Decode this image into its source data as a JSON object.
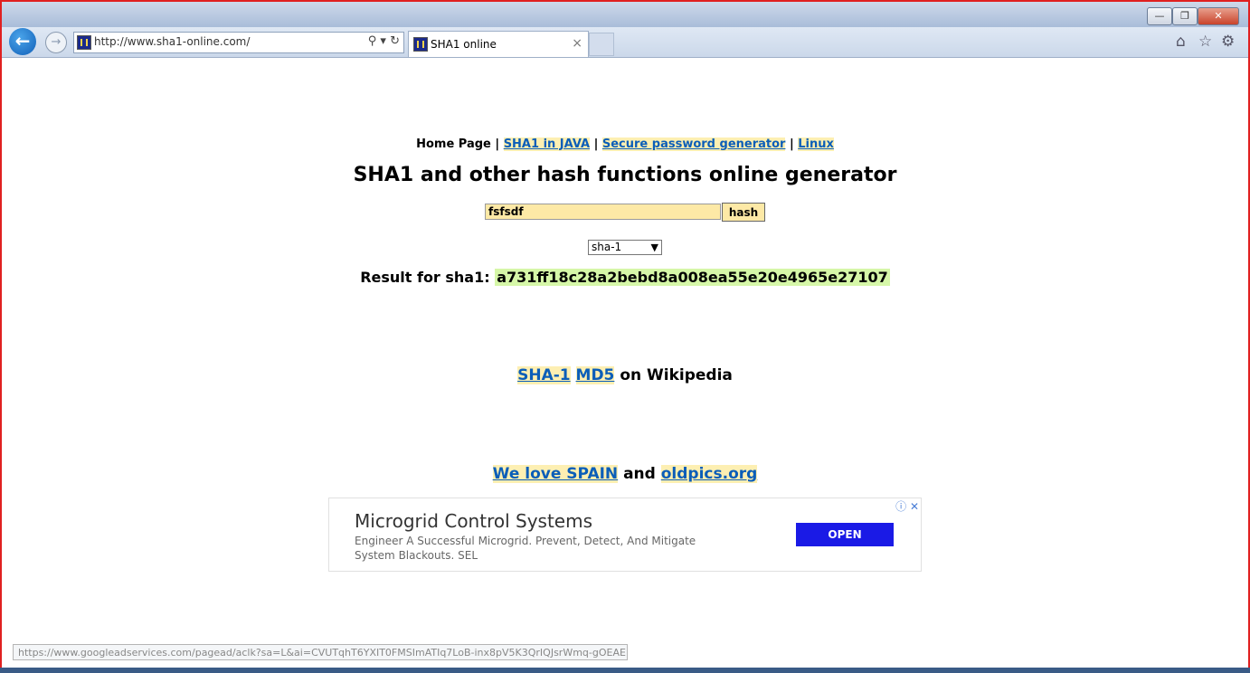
{
  "browser": {
    "address_url": "http://www.sha1-online.com/",
    "tab_title": "SHA1 online",
    "tab_close": "×",
    "back_glyph": "←",
    "forward_glyph": "→",
    "addr_icons": "⚲ ▾ ↻",
    "min_glyph": "—",
    "max_glyph": "❐",
    "close_glyph": "✕",
    "home_glyph": "⌂",
    "fav_glyph": "☆",
    "settings_glyph": "⚙"
  },
  "nav": {
    "home": "Home Page",
    "sep": "|",
    "sha1_java": "SHA1 in JAVA",
    "password_gen": "Secure password generator",
    "linux": "Linux"
  },
  "page_title": "SHA1 and other hash functions online generator",
  "form": {
    "input_value": "fsfsdf",
    "hash_button": "hash",
    "algorithm": "sha-1"
  },
  "result": {
    "label": "Result for sha1:",
    "hash": "a731ff18c28a2bebd8a008ea55e20e4965e27107"
  },
  "wiki": {
    "sha1": "SHA-1",
    "md5": "MD5",
    "suffix": "on Wikipedia"
  },
  "spain": {
    "link1": "We love SPAIN",
    "and": "and",
    "link2": "oldpics.org"
  },
  "ad": {
    "title": "Microgrid Control Systems",
    "description": "Engineer A Successful Microgrid. Prevent, Detect, And Mitigate System Blackouts. SEL",
    "button": "OPEN",
    "icons": "ⓘ ✕"
  },
  "status_url": "https://www.googleadservices.com/pagead/aclk?sa=L&ai=CVUTqhT6YXIT0FMSImATIq7LoB-inx8pV5K3QrIQJsrWmq-gOEAE..."
}
